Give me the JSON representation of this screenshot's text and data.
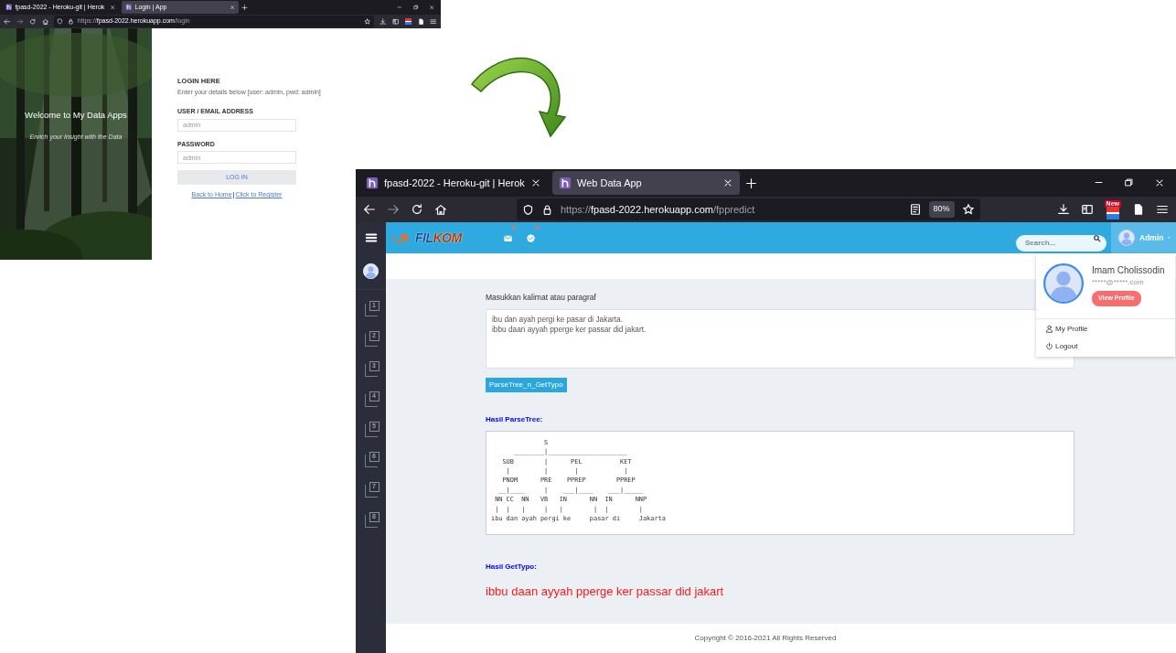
{
  "login_window": {
    "tabs": [
      {
        "label": "fpasd-2022 - Heroku-git | Herok",
        "selected": false
      },
      {
        "label": "Login | App",
        "selected": true
      }
    ],
    "url": {
      "scheme": "https://",
      "host": "fpasd-2022.herokuapp.com",
      "path": "/login"
    },
    "hero": {
      "title": "Welcome to My Data Apps",
      "subtitle": "Enrich your Insight with the Data"
    },
    "form": {
      "heading": "LOGIN HERE",
      "hint": "Enter your details below [user: admin, pwd: admin]",
      "fields": [
        {
          "label": "USER / EMAIL ADDRESS",
          "placeholder": "admin"
        },
        {
          "label": "PASSWORD",
          "placeholder": "admin"
        }
      ],
      "submit": "LOG IN",
      "links": [
        "Back to Home",
        "Click to Register"
      ],
      "separator": "|"
    }
  },
  "main_window": {
    "tabs": [
      {
        "label": "fpasd-2022 - Heroku-git | Herok",
        "selected": false
      },
      {
        "label": "Web Data App",
        "selected": true
      }
    ],
    "url": {
      "scheme": "https://",
      "host": "fpasd-2022.herokuapp.com",
      "path": "/fppredict"
    },
    "zoom": "80%",
    "extension_badge": "New",
    "app": {
      "logo": [
        "FIL",
        "KOM"
      ],
      "search": {
        "placeholder": "Search..."
      },
      "user": "Admin",
      "sidebar_items": [
        {
          "label": "1"
        },
        {
          "label": "2"
        },
        {
          "label": "3"
        },
        {
          "label": "4"
        },
        {
          "label": "5"
        },
        {
          "label": "6"
        },
        {
          "label": "7"
        },
        {
          "label": "8"
        }
      ],
      "dropdown": {
        "name": "Imam Cholissodin",
        "email": "*****@*****.com",
        "button": "View Profile",
        "items": [
          {
            "kind": "profile",
            "label": "My Profile"
          },
          {
            "kind": "logout",
            "label": "Logout"
          }
        ]
      },
      "input_label": "Masukkan kalimat atau paragraf",
      "input_value": "ibu dan ayah pergi ke pasar di Jakarta.\nibbu daan ayyah pperge ker passar did jakart.",
      "submit": "ParseTree_n_GetTypo",
      "parse_heading": "Hasil ParseTree:",
      "parse_tree": [
        "              S",
        "      ________|_____________________",
        "   SUB        |      PEL          KET",
        "    |         |       |            |",
        "   PNOM      PRE    PPREP        PPREP",
        "  __|____     |    ___|____    ___|_____",
        " NN CC  NN   VB   IN      NN  IN      NNP",
        " |  |   |     |   |        |  |        |",
        "ibu dan ayah pergi ke     pasar di     Jakarta"
      ],
      "typo_heading": "Hasil GetTypo:",
      "typo_result": "ibbu daan ayyah pperge ker passar did jakart",
      "footer": "Copyright © 2016-2021 All Rights Reserved"
    }
  }
}
